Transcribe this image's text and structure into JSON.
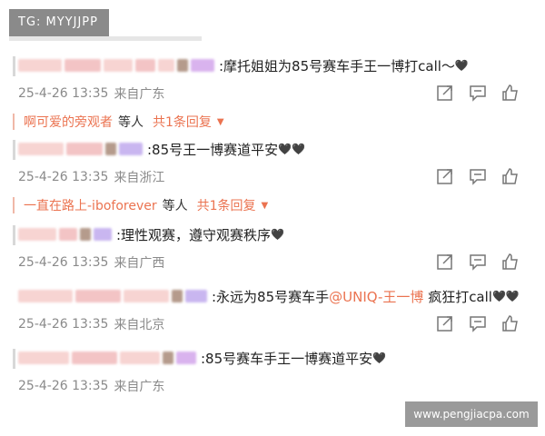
{
  "watermark_top": "TG: MYYJJPP",
  "watermark_bottom": "www.pengjiacpa.com",
  "comments": [
    {
      "text": ":摩托姐姐为85号赛车手王一博打call～",
      "heart": "🖤",
      "time": "25-4-26 13:35",
      "location": "来自广东",
      "replies": {
        "name": "啊可爱的旁观者",
        "suffix": "等人",
        "count": "共1条回复"
      }
    },
    {
      "text": ":85号王一博赛道平安",
      "heart": "🖤🖤",
      "time": "25-4-26 13:35",
      "location": "来自浙江",
      "replies": {
        "name": "一直在路上-iboforever",
        "suffix": "等人",
        "count": "共1条回复"
      }
    },
    {
      "text": ":理性观赛，遵守观赛秩序",
      "heart": "🖤",
      "time": "25-4-26 13:35",
      "location": "来自广西"
    },
    {
      "text_before": ":永远为85号赛车手",
      "mention": "@UNIQ-王一博",
      "text_after": " 疯狂打call",
      "heart": "🖤🖤",
      "time": "25-4-26 13:35",
      "location": "来自北京"
    },
    {
      "text": ":85号赛车手王一博赛道平安",
      "heart": "🖤",
      "time": "25-4-26 13:35",
      "location": "来自广东"
    }
  ],
  "icons": [
    "share-icon",
    "comment-icon",
    "like-icon"
  ]
}
